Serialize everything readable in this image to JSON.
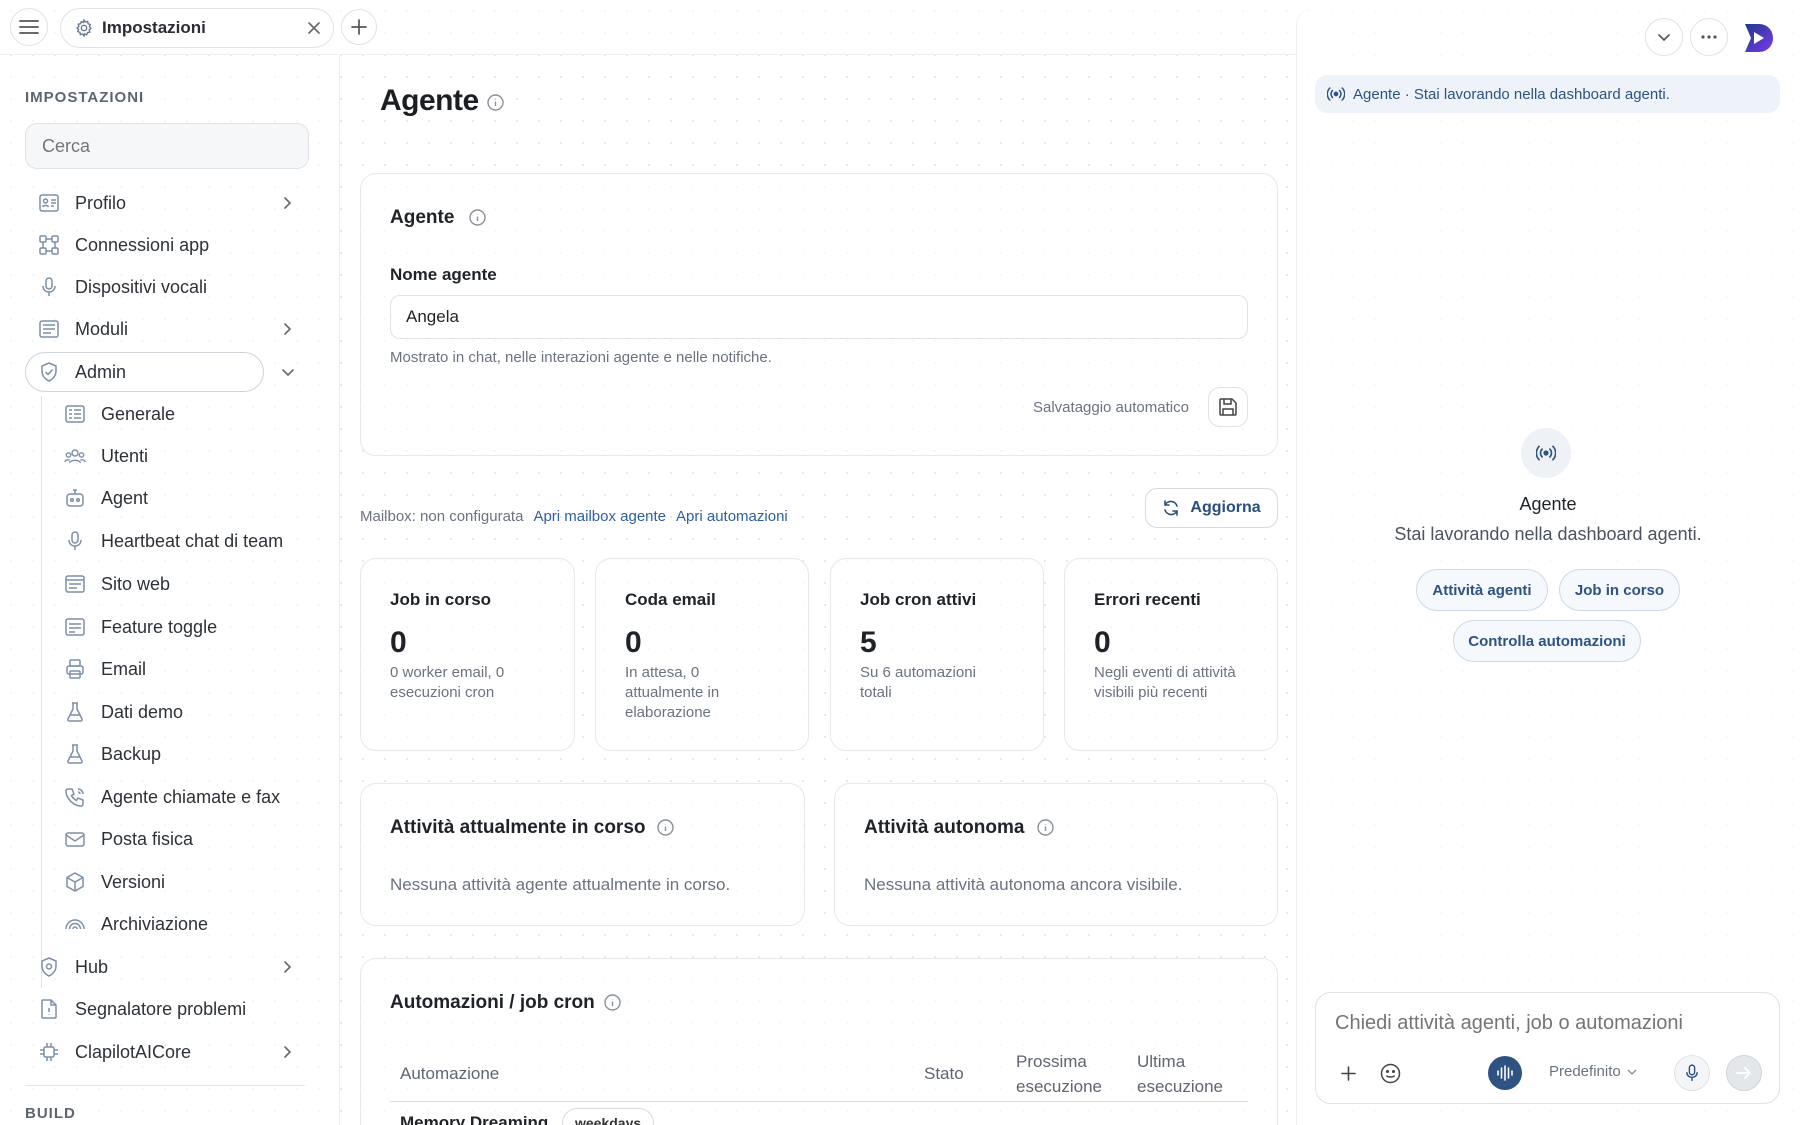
{
  "topbar": {
    "tab_label": "Impostazioni"
  },
  "sidebar": {
    "title": "IMPOSTAZIONI",
    "search_placeholder": "Cerca",
    "items": [
      {
        "label": "Profilo",
        "icon": "id-card-icon",
        "chevron": "right"
      },
      {
        "label": "Connessioni app",
        "icon": "connections-icon"
      },
      {
        "label": "Dispositivi vocali",
        "icon": "microphone-icon"
      },
      {
        "label": "Moduli",
        "icon": "modules-icon",
        "chevron": "right"
      },
      {
        "label": "Admin",
        "icon": "shield-icon",
        "chevron": "down",
        "active": true
      }
    ],
    "admin_items": [
      {
        "label": "Generale",
        "icon": "list-icon"
      },
      {
        "label": "Utenti",
        "icon": "users-icon"
      },
      {
        "label": "Agent",
        "icon": "robot-icon"
      },
      {
        "label": "Heartbeat chat di team",
        "icon": "microphone-icon"
      },
      {
        "label": "Sito web",
        "icon": "browser-icon"
      },
      {
        "label": "Feature toggle",
        "icon": "toggle-icon"
      },
      {
        "label": "Email",
        "icon": "printer-icon"
      },
      {
        "label": "Dati demo",
        "icon": "flask-icon"
      },
      {
        "label": "Backup",
        "icon": "flask-icon"
      },
      {
        "label": "Agente chiamate e fax",
        "icon": "phone-icon"
      },
      {
        "label": "Posta fisica",
        "icon": "mail-tray-icon"
      },
      {
        "label": "Versioni",
        "icon": "cube-icon"
      },
      {
        "label": "Archiviazione",
        "icon": "archive-icon"
      }
    ],
    "bottom_items": [
      {
        "label": "Hub",
        "icon": "shield-icon",
        "chevron": "right"
      },
      {
        "label": "Segnalatore problemi",
        "icon": "document-icon"
      },
      {
        "label": "ClapilotAICore",
        "icon": "chip-icon",
        "chevron": "right"
      }
    ],
    "section_build": "BUILD"
  },
  "main": {
    "title": "Agente",
    "agent_card": {
      "title": "Agente",
      "name_label": "Nome agente",
      "name_value": "Angela",
      "name_hint": "Mostrato in chat, nelle interazioni agente e nelle notifiche.",
      "autosave_label": "Salvataggio automatico"
    },
    "mailbox": {
      "status": "Mailbox: non configurata",
      "open_mailbox": "Apri mailbox agente",
      "open_automations": "Apri automazioni"
    },
    "refresh_label": "Aggiorna",
    "stats": [
      {
        "title": "Job in corso",
        "value": "0",
        "desc": "0 worker email, 0 esecuzioni cron"
      },
      {
        "title": "Coda email",
        "value": "0",
        "desc": "In attesa, 0 attualmente in elaborazione"
      },
      {
        "title": "Job cron attivi",
        "value": "5",
        "desc": "Su 6 automazioni totali"
      },
      {
        "title": "Errori recenti",
        "value": "0",
        "desc": "Negli eventi di attività visibili più recenti"
      }
    ],
    "current_activity": {
      "title": "Attività attualmente in corso",
      "empty": "Nessuna attività agente attualmente in corso."
    },
    "autonomous_activity": {
      "title": "Attività autonoma",
      "empty": "Nessuna attività autonoma ancora visibile."
    },
    "automations": {
      "title": "Automazioni / job cron",
      "columns": [
        "Automazione",
        "Stato",
        "Prossima esecuzione",
        "Ultima esecuzione"
      ],
      "rows": [
        {
          "name": "Memory Dreaming",
          "tag": "weekdays"
        }
      ]
    }
  },
  "right_panel": {
    "banner": "Agente · Stai lavorando nella dashboard agenti.",
    "agent_name": "Agente",
    "agent_subtitle": "Stai lavorando nella dashboard agenti.",
    "chips": [
      "Attività agenti",
      "Job in corso",
      "Controlla automazioni"
    ],
    "composer": {
      "placeholder": "Chiedi attività agenti, job o automazioni",
      "model": "Predefinito"
    }
  },
  "colors": {
    "accent": "#2e5282",
    "link": "#2f5f9e",
    "icon": "#7d8fa8"
  }
}
